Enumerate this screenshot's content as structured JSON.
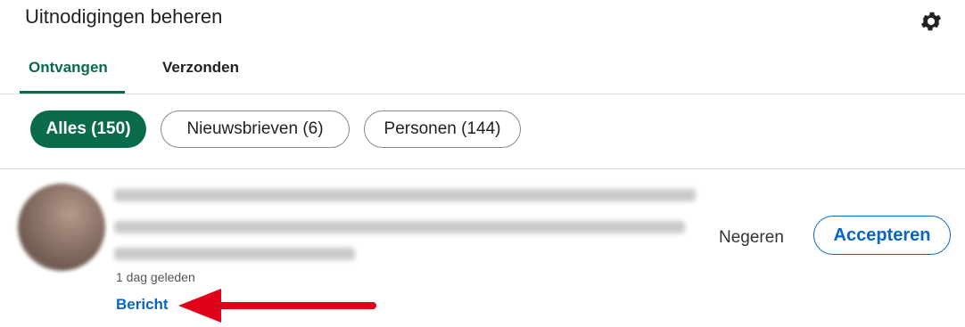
{
  "header": {
    "title": "Uitnodigingen beheren",
    "settings_icon": "gear-icon"
  },
  "tabs": [
    {
      "label": "Ontvangen",
      "active": true
    },
    {
      "label": "Verzonden",
      "active": false
    }
  ],
  "filters": [
    {
      "label": "Alles (150)",
      "active": true
    },
    {
      "label": "Nieuwsbrieven (6)",
      "active": false
    },
    {
      "label": "Personen (144)",
      "active": false
    }
  ],
  "invitation": {
    "time": "1 dag geleden",
    "message_label": "Bericht",
    "ignore_label": "Negeren",
    "accept_label": "Accepteren"
  },
  "colors": {
    "accent_green": "#0a6b4b",
    "link_blue": "#0a66c2",
    "arrow_red": "#e0001a"
  }
}
